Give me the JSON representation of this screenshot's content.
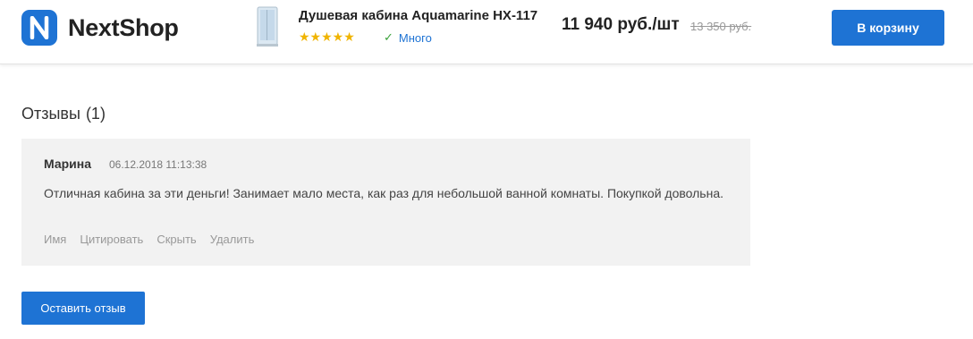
{
  "header": {
    "logo_text": "NextShop",
    "product": {
      "title": "Душевая кабина Aquamarine HX-117",
      "rating": "★★★★★",
      "stock": "Много",
      "price": "11 940 руб./шт",
      "old_price": "13 350 руб."
    },
    "cart_button": "В корзину"
  },
  "reviews": {
    "title": "Отзывы",
    "count": "(1)",
    "items": [
      {
        "author": "Марина",
        "date": "06.12.2018 11:13:38",
        "text": "Отличная кабина за эти деньги! Занимает мало места, как раз для небольшой ванной комнаты. Покупкой довольна.",
        "actions": [
          "Имя",
          "Цитировать",
          "Скрыть",
          "Удалить"
        ]
      }
    ],
    "leave_button": "Оставить отзыв"
  },
  "colors": {
    "accent": "#1e73d4",
    "star": "#f0b400",
    "review_bg": "#f2f2f2"
  }
}
